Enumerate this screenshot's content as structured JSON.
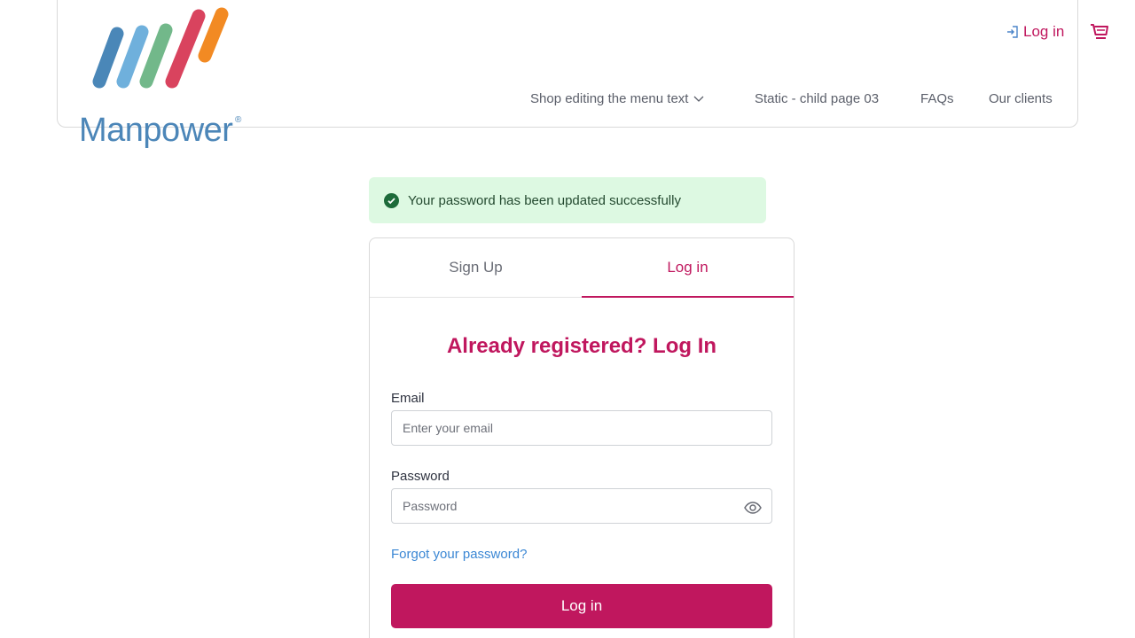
{
  "brand": {
    "name": "Manpower",
    "registered": "®",
    "colors": [
      "#4a87b8",
      "#6fb0dc",
      "#72b88a",
      "#d9435e",
      "#f28a23"
    ]
  },
  "header": {
    "login_label": "Log in",
    "login_icon": "login-arrow-icon",
    "cart_icon": "shopping-cart-icon",
    "nav": [
      {
        "label": "Shop editing the menu text",
        "has_dropdown": true
      },
      {
        "label": "Static - child page 03"
      },
      {
        "label": "FAQs"
      },
      {
        "label": "Our clients"
      }
    ]
  },
  "alert": {
    "icon": "check-circle-icon",
    "message": "Your password has been updated successfully",
    "background": "#ddf9e2"
  },
  "auth": {
    "tabs": [
      {
        "label": "Sign Up",
        "active": false
      },
      {
        "label": "Log in",
        "active": true
      }
    ],
    "heading": "Already registered? Log In",
    "email": {
      "label": "Email",
      "placeholder": "Enter your email",
      "value": ""
    },
    "password": {
      "label": "Password",
      "placeholder": "Password",
      "value": "",
      "toggle_icon": "eye-icon"
    },
    "forgot_label": "Forgot your password?",
    "submit_label": "Log in",
    "accent": "#c0175e"
  }
}
